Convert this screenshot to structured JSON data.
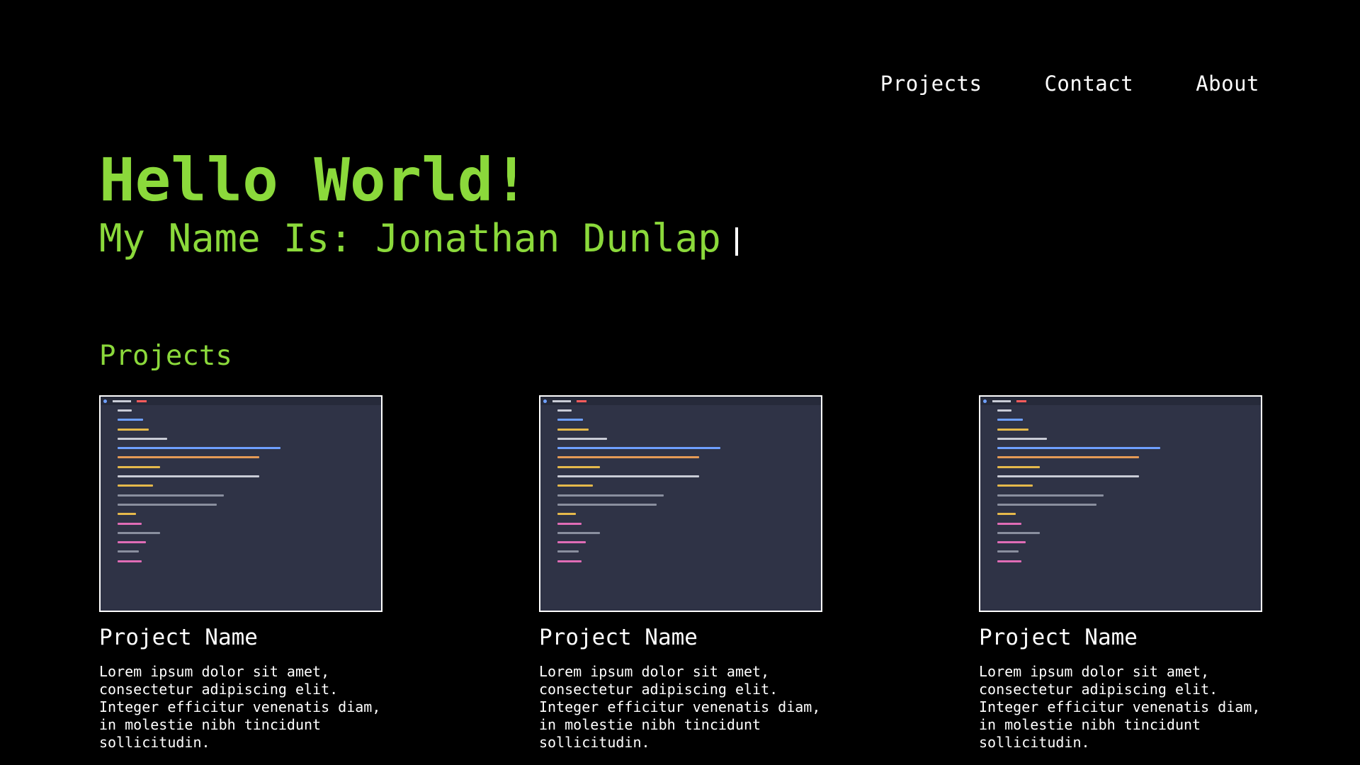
{
  "nav": {
    "items": [
      "Projects",
      "Contact",
      "About"
    ]
  },
  "hero": {
    "title": "Hello World!",
    "subtitle": "My Name Is: Jonathan Dunlap"
  },
  "projects": {
    "heading": "Projects",
    "cards": [
      {
        "title": "Project Name",
        "description": "Lorem ipsum dolor sit amet, consectetur adipiscing elit. Integer efficitur venenatis diam, in molestie nibh tincidunt sollicitudin."
      },
      {
        "title": "Project Name",
        "description": "Lorem ipsum dolor sit amet, consectetur adipiscing elit. Integer efficitur venenatis diam, in molestie nibh tincidunt sollicitudin."
      },
      {
        "title": "Project Name",
        "description": "Lorem ipsum dolor sit amet, consectetur adipiscing elit. Integer efficitur venenatis diam, in molestie nibh tincidunt sollicitudin."
      }
    ]
  },
  "colors": {
    "background": "#000000",
    "accent": "#8bd93b",
    "text": "#ffffff",
    "thumbnail_bg": "#2f3346"
  }
}
